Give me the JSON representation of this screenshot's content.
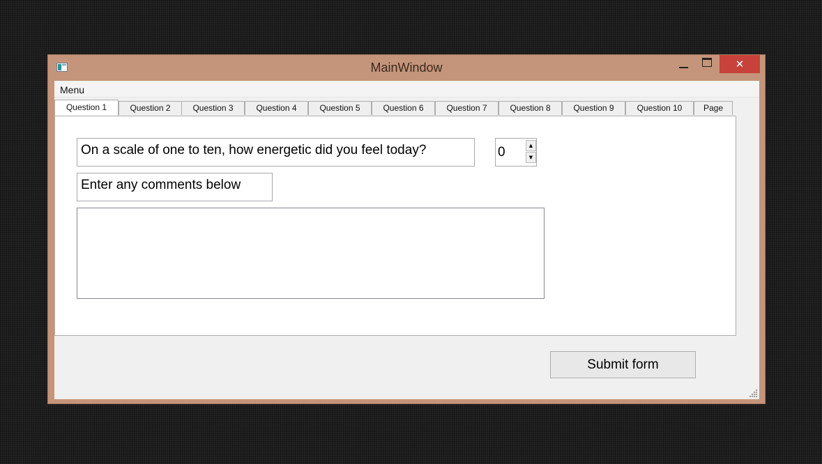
{
  "window": {
    "title": "MainWindow",
    "close_glyph": "✕",
    "accent_color": "#c4957a",
    "close_color": "#c7423a"
  },
  "menubar": {
    "items": [
      "Menu"
    ]
  },
  "tabs": [
    {
      "label": "Question 1",
      "active": true
    },
    {
      "label": "Question 2"
    },
    {
      "label": "Question 3"
    },
    {
      "label": "Question 4"
    },
    {
      "label": "Question 5"
    },
    {
      "label": "Question 6"
    },
    {
      "label": "Question 7"
    },
    {
      "label": "Question 8"
    },
    {
      "label": "Question 9"
    },
    {
      "label": "Question 10"
    },
    {
      "label": "Page"
    }
  ],
  "form": {
    "question": "On a scale of one to ten, how energetic did you feel today?",
    "spin_value": "0",
    "comments_label": "Enter any comments below",
    "comments_value": "",
    "submit_label": "Submit form"
  },
  "icons": {
    "app": "app-window-icon",
    "minimize": "minimize-icon",
    "maximize": "maximize-icon",
    "close": "close-icon",
    "spin_up": "arrow-up-icon",
    "spin_down": "arrow-down-icon",
    "grip": "resize-grip-icon"
  }
}
